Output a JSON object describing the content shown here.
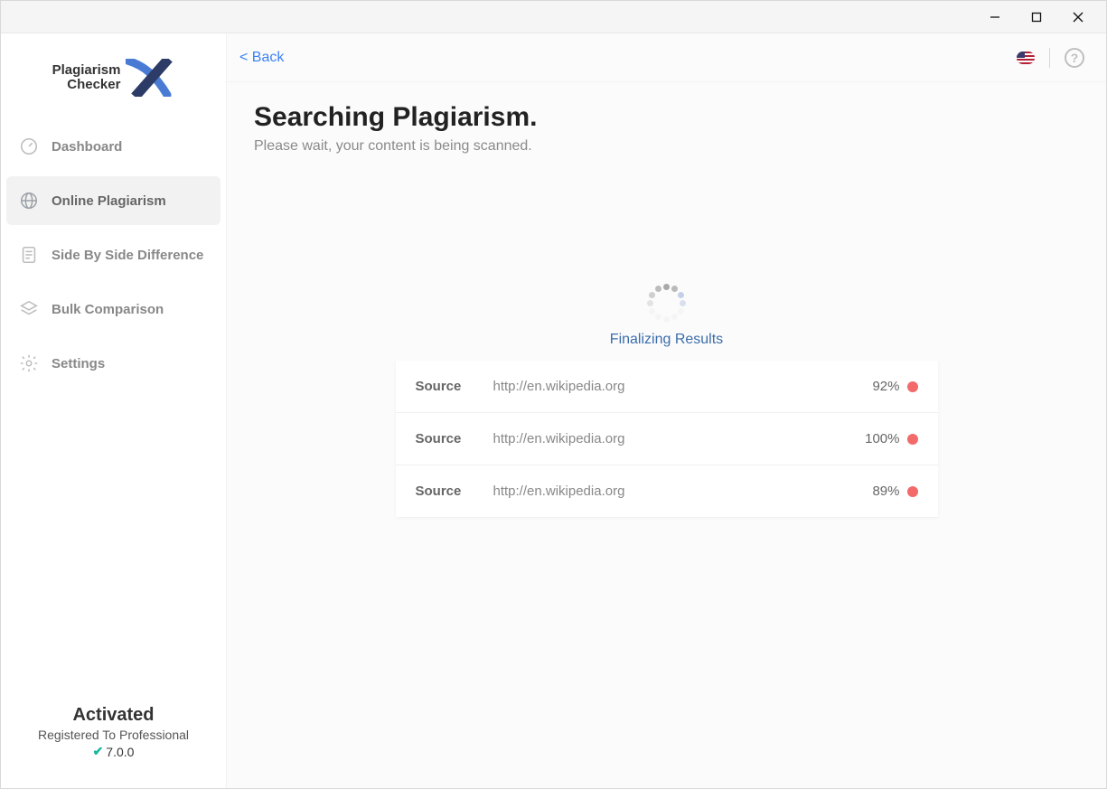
{
  "window": {
    "min": "–",
    "max": "▢",
    "close": "✕"
  },
  "logo": {
    "line1": "Plagiarism",
    "line2": "Checker"
  },
  "sidebar": {
    "items": [
      {
        "label": "Dashboard"
      },
      {
        "label": "Online Plagiarism"
      },
      {
        "label": "Side By Side Difference"
      },
      {
        "label": "Bulk Comparison"
      },
      {
        "label": "Settings"
      }
    ],
    "active_index": 1,
    "footer": {
      "title": "Activated",
      "subtitle": "Registered To Professional",
      "version": "7.0.0"
    }
  },
  "topbar": {
    "back": "<  Back",
    "help": "?"
  },
  "page": {
    "title": "Searching Plagiarism.",
    "subtitle": "Please wait, your content is being scanned."
  },
  "scan": {
    "status": "Finalizing Results",
    "source_label": "Source",
    "results": [
      {
        "url": "http://en.wikipedia.org",
        "pct": "92%",
        "color": "#f26a6a"
      },
      {
        "url": "http://en.wikipedia.org",
        "pct": "100%",
        "color": "#f26a6a"
      },
      {
        "url": "http://en.wikipedia.org",
        "pct": "89%",
        "color": "#f26a6a"
      }
    ]
  }
}
